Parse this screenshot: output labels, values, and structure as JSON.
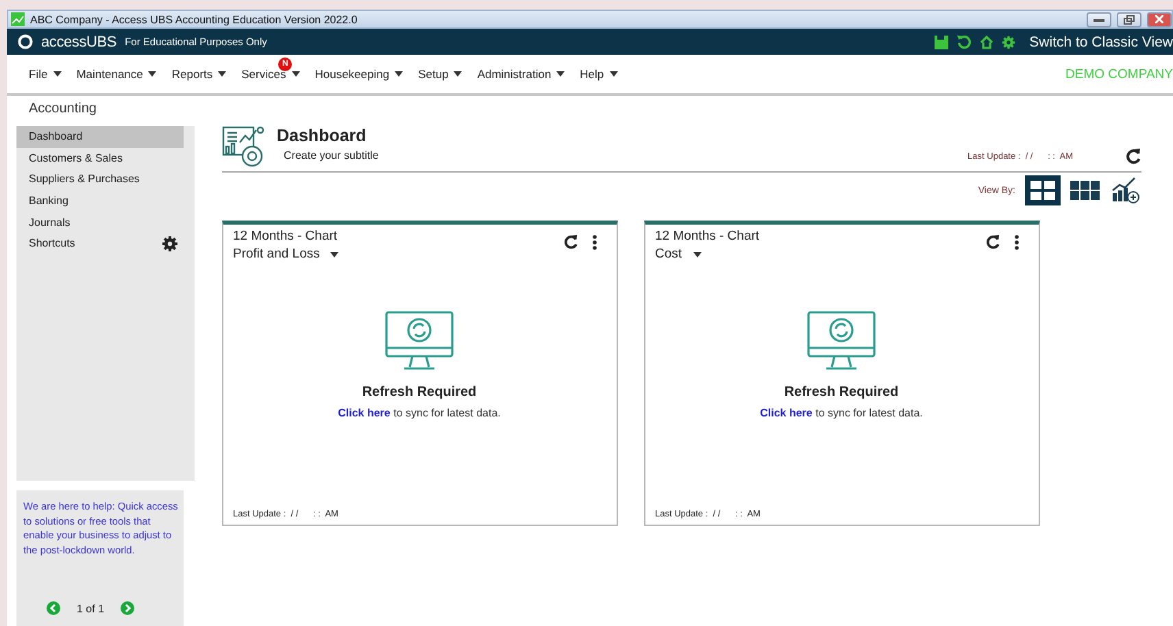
{
  "window": {
    "title": "ABC Company - Access UBS Accounting Education Version 2022.0"
  },
  "brand": {
    "logo": "accessUBS",
    "tagline": "For Educational Purposes Only",
    "classic_view": "Switch to Classic View"
  },
  "menu": [
    {
      "label": "File"
    },
    {
      "label": "Maintenance"
    },
    {
      "label": "Reports"
    },
    {
      "label": "Services",
      "badge": "N"
    },
    {
      "label": "Housekeeping"
    },
    {
      "label": "Setup"
    },
    {
      "label": "Administration"
    },
    {
      "label": "Help"
    }
  ],
  "company": "DEMO COMPANY",
  "sidebar": {
    "section": "Accounting",
    "items": [
      {
        "label": "Dashboard",
        "selected": true,
        "kind": "link"
      },
      {
        "label": "Customers & Sales",
        "selected": false,
        "kind": "link"
      },
      {
        "label": "Suppliers & Purchases",
        "selected": false,
        "kind": "link"
      },
      {
        "label": "Banking",
        "selected": false,
        "kind": "link"
      },
      {
        "label": "Journals",
        "selected": false,
        "kind": "link"
      },
      {
        "label": "Shortcuts",
        "selected": false,
        "kind": "settings"
      }
    ],
    "help": "We are here to help: Quick access to solutions or free tools that enable your business to adjust to the post-lockdown world.",
    "pager": "1 of 1"
  },
  "dashboard": {
    "title": "Dashboard",
    "subtitle": "Create your subtitle",
    "last_update": "Last Update :  / /      : :  AM",
    "view_by": "View By:",
    "views": [
      {
        "kind": "grid4",
        "selected": true
      },
      {
        "kind": "grid6",
        "selected": false
      },
      {
        "kind": "chart",
        "selected": false
      }
    ]
  },
  "cards": [
    {
      "title": "12 Months - Chart",
      "selector": "Profit and Loss",
      "status": "Refresh Required",
      "link": "Click here",
      "message": " to sync for latest data.",
      "last_update": "Last Update :  / /      : :  AM"
    },
    {
      "title": "12 Months - Chart",
      "selector": "Cost",
      "status": "Refresh Required",
      "link": "Click here",
      "message": " to sync for latest data.",
      "last_update": "Last Update :  / /      : :  AM"
    }
  ]
}
